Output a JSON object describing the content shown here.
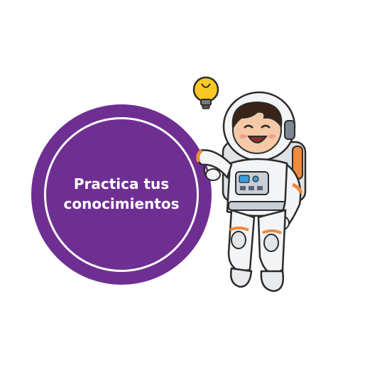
{
  "badge": {
    "line1": "Practica tus",
    "line2": "conocimientos",
    "color": "#6f2f92",
    "ring_color": "#ffffff"
  },
  "illustration": {
    "subject": "astronaut-character",
    "icon": "lightbulb-icon"
  }
}
